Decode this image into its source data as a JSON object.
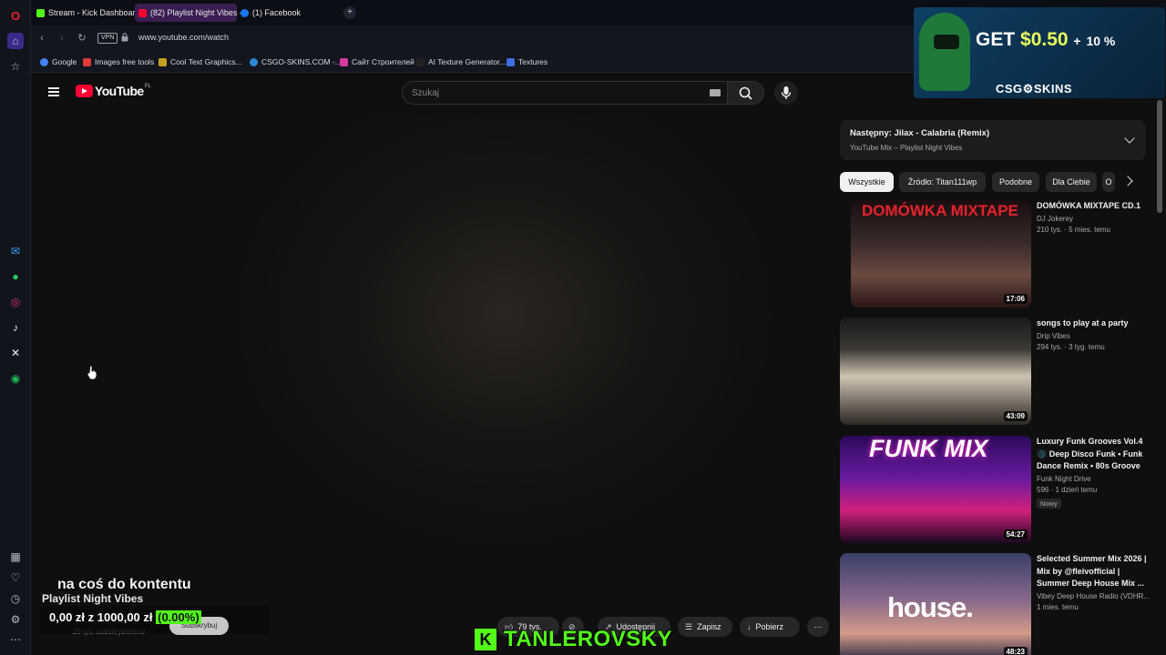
{
  "browser": {
    "tabs": [
      {
        "label": "Stream - Kick Dashboard",
        "color": "#53fc18"
      },
      {
        "label": "(82) Playlist Night Vibes -",
        "color": "#ff0033"
      },
      {
        "label": "(1) Facebook",
        "color": "#1877f2"
      }
    ],
    "new_tab": "+",
    "url": "www.youtube.com/watch",
    "vpn_label": "VPN",
    "bookmarks": [
      {
        "label": "Google",
        "color": "#4285f4"
      },
      {
        "label": "Images free tools",
        "color": "#e03a3a"
      },
      {
        "label": "Cool Text Graphics...",
        "color": "#c8a020"
      },
      {
        "label": "CSGO-SKINS.COM -...",
        "color": "#2b8ad8"
      },
      {
        "label": "Сайт Строителей",
        "color": "#d63aa0"
      },
      {
        "label": "AI Texture Generator...",
        "color": "#222222"
      },
      {
        "label": "Textures",
        "color": "#3d6fe0"
      }
    ]
  },
  "youtube": {
    "logo_text": "YouTube",
    "region": "PL",
    "search_placeholder": "Szukaj"
  },
  "stream_overlay": {
    "caption": "na coś do kontentu",
    "channel": "Playlist Night Vibes",
    "donation_amount": "0,00 zł",
    "donation_of": "z",
    "donation_goal": "1000,00 zł",
    "donation_percent": "(0.00%)",
    "subscribe": "Subskrybuj",
    "subs_count": "29 tys. subskrybentów",
    "kick_letter": "K",
    "kick_name": "TANLEROVSKY"
  },
  "actions": {
    "likes": "79 tys.",
    "share": "Udostępnij",
    "save": "Zapisz",
    "download": "Pobierz",
    "more": "⋯"
  },
  "ad": {
    "offer_prefix": "GET",
    "offer_money": "$0.50",
    "offer_plus": "+",
    "offer_pct": "10 %",
    "brand": "CSG⚙SKINS"
  },
  "sidebar_right": {
    "next_title": "Następny: Jilax - Calabria (Remix)",
    "next_sub": "YouTube Mix – Playlist Night Vibes",
    "chips": [
      "Wszystkie",
      "Źródło: Titan111wp",
      "Podobne",
      "Dla Ciebie",
      "O"
    ],
    "videos": [
      {
        "title": "DOMÓWKA MIXTAPE CD.1",
        "channel": "DJ Jokerey",
        "views": "210 tys.",
        "age": "5 mies. temu",
        "duration": "17:06",
        "thumb_text": "DOMÓWKA MIXTAPE",
        "badge": ""
      },
      {
        "title": "songs to play at a party",
        "channel": "Drip Vibes",
        "views": "294 tys.",
        "age": "3 tyg. temu",
        "duration": "43:09",
        "thumb_text": "",
        "badge": ""
      },
      {
        "title": "Luxury Funk Grooves Vol.4 🌑 Deep Disco Funk • Funk Dance Remix • 80s Groove",
        "channel": "Funk Night Drive",
        "views": "596",
        "age": "1 dzień temu",
        "duration": "54:27",
        "thumb_text": "FUNK MIX",
        "badge": "Nowy"
      },
      {
        "title": "Selected Summer Mix 2026 | Mix by @fleivofficial | Summer Deep House Mix ...",
        "channel": "Vibey Deep House Radio (VDHR...",
        "views": "",
        "age": "1 mies. temu",
        "duration": "48:23",
        "thumb_text": "house.",
        "badge": ""
      }
    ]
  }
}
